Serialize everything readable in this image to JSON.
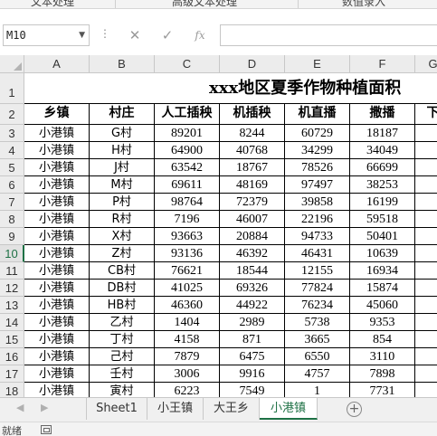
{
  "ribbon": {
    "groups": [
      "文本处理",
      "高级文本处理",
      "数值录入"
    ]
  },
  "formula_bar": {
    "name_box": "M10",
    "cancel_icon": "✕",
    "enter_icon": "✓",
    "function_icon": "fx",
    "formula": ""
  },
  "columns": [
    "A",
    "B",
    "C",
    "D",
    "E",
    "F",
    "G"
  ],
  "rows": [
    "1",
    "2",
    "3",
    "4",
    "5",
    "6",
    "7",
    "8",
    "9",
    "10",
    "11",
    "12",
    "13",
    "14",
    "15",
    "16",
    "17",
    "18"
  ],
  "active_row": "10",
  "sheet": {
    "title": "xxx地区夏季作物种植面积",
    "headers": [
      "乡镇",
      "村庄",
      "人工插秧",
      "机插秧",
      "机直播",
      "撒播",
      "下"
    ],
    "data": [
      [
        "小港镇",
        "G村",
        "89201",
        "8244",
        "60729",
        "18187",
        "6"
      ],
      [
        "小港镇",
        "H村",
        "64900",
        "40768",
        "34299",
        "34049",
        "6"
      ],
      [
        "小港镇",
        "J村",
        "63542",
        "18767",
        "78526",
        "66699",
        "6"
      ],
      [
        "小港镇",
        "M村",
        "69611",
        "48169",
        "97497",
        "38253",
        "1"
      ],
      [
        "小港镇",
        "P村",
        "98764",
        "72379",
        "39858",
        "16199",
        "1"
      ],
      [
        "小港镇",
        "R村",
        "7196",
        "46007",
        "22196",
        "59518",
        "1"
      ],
      [
        "小港镇",
        "X村",
        "93663",
        "20884",
        "94733",
        "50401",
        "2"
      ],
      [
        "小港镇",
        "Z村",
        "93136",
        "46392",
        "46431",
        "10639",
        "9"
      ],
      [
        "小港镇",
        "CB村",
        "76621",
        "18544",
        "12155",
        "16934",
        "1"
      ],
      [
        "小港镇",
        "DB村",
        "41025",
        "69326",
        "77824",
        "15874",
        "7"
      ],
      [
        "小港镇",
        "HB村",
        "46360",
        "44922",
        "76234",
        "45060",
        "1"
      ],
      [
        "小港镇",
        "乙村",
        "1404",
        "2989",
        "5738",
        "9353",
        "9"
      ],
      [
        "小港镇",
        "丁村",
        "4158",
        "871",
        "3665",
        "854",
        "9"
      ],
      [
        "小港镇",
        "己村",
        "7879",
        "6475",
        "6550",
        "3110",
        "9"
      ],
      [
        "小港镇",
        "壬村",
        "3006",
        "9916",
        "4757",
        "7898",
        "2"
      ],
      [
        "小港镇",
        "寅村",
        "6223",
        "7549",
        "1",
        "7731",
        "6"
      ]
    ]
  },
  "tabs": [
    "Sheet1",
    "小王镇",
    "大王乡",
    "小港镇"
  ],
  "active_tab": "小港镇",
  "tab_nav": {
    "prev": "◀",
    "next": "▶",
    "add": "+"
  },
  "status": {
    "text": "就绪"
  },
  "colors": {
    "accent": "#1e7145",
    "grid_line": "#000000",
    "header_bg": "#ececec"
  }
}
